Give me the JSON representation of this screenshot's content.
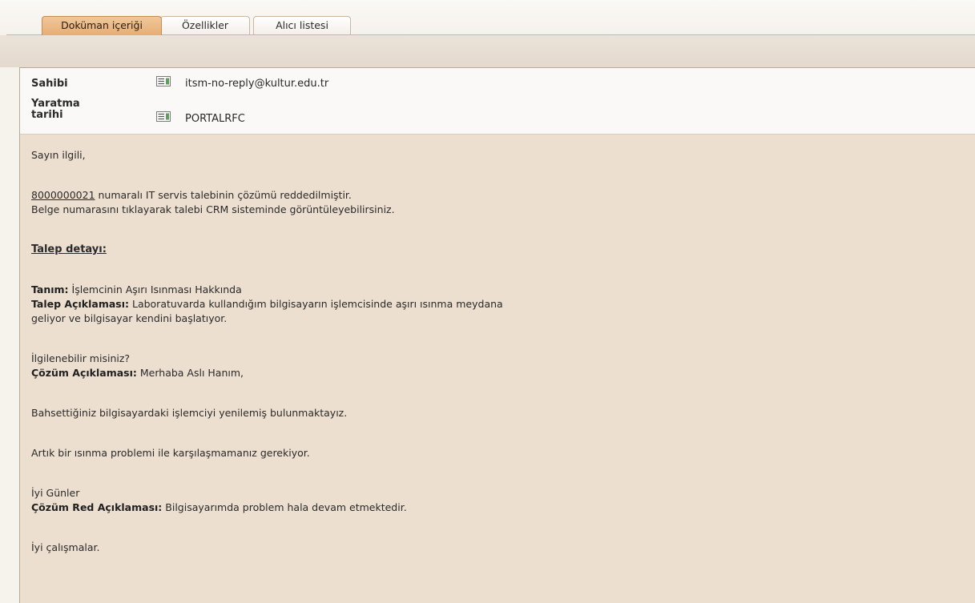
{
  "tabs": [
    {
      "label": "Doküman içeriği",
      "active": true
    },
    {
      "label": "Özellikler",
      "active": false
    },
    {
      "label": "Alıcı listesi",
      "active": false
    }
  ],
  "meta": {
    "owner_label": "Sahibi",
    "owner_value": "itsm-no-reply@kultur.edu.tr",
    "created_label_line1": "Yaratma",
    "created_label_line2": "tarihi",
    "created_value": "PORTALRFC",
    "icon": "edit-record-icon"
  },
  "message": {
    "greeting": "Sayın ilgili,",
    "ticket_number": "8000000021",
    "line1_rest": " numaralı IT servis talebinin çözümü reddedilmiştir.",
    "line2": "Belge numarasını tıklayarak talebi CRM sisteminde görüntüleyebilirsiniz.",
    "details_heading": "Talep detayı:",
    "definition_label": "Tanım:",
    "definition_value": " İşlemcinin Aşırı Isınması Hakkında",
    "request_desc_label": "Talep Açıklaması:",
    "request_desc_value_1": " Laboratuvarda kullandığım bilgisayarın işlemcisinde aşırı ısınma meydana",
    "request_desc_value_2": "geliyor ve bilgisayar kendini başlatıyor.",
    "request_question": "İlgilenebilir misiniz?",
    "solution_desc_label": "Çözüm Açıklaması:",
    "solution_desc_value": " Merhaba Aslı Hanım,",
    "solution_line1": "Bahsettiğiniz bilgisayardaki işlemciyi yenilemiş bulunmaktayız.",
    "solution_line2": "Artık bir ısınma problemi ile karşılaşmamanız gerekiyor.",
    "solution_closing": "İyi Günler",
    "rejection_label": "Çözüm Red Açıklaması:",
    "rejection_value": " Bilgisayarımda problem hala devam etmektedir.",
    "signoff": "İyi çalışmalar."
  },
  "colors": {
    "active_tab": "#e6ad73",
    "panel_bg": "#ecdfd0",
    "meta_bg": "#fbf9f7"
  }
}
